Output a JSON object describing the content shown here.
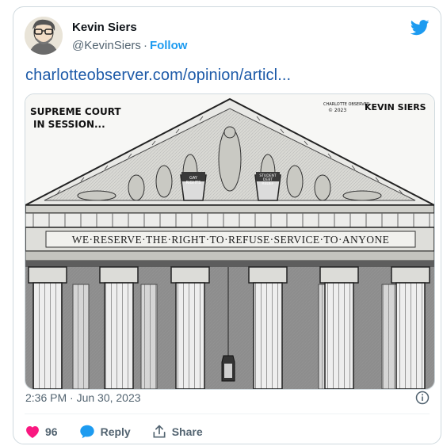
{
  "tweet": {
    "author_name": "Kevin Siers",
    "handle": "@KevinSiers",
    "separator": "·",
    "follow_label": "Follow",
    "link_text": "charlotteobserver.com/opinion/articl...",
    "timestamp": "2:36 PM · Jun 30, 2023"
  },
  "cartoon": {
    "caption": [
      "SUPREME COURT",
      "IN SESSION..."
    ],
    "credit_line1": "CHARLOTTE OBSERVER",
    "credit_line2": "© 2023",
    "signature": "KEVIN SIERS",
    "frieze_text": "WE·RESERVE·THE·RIGHT·TO·REFUSE·SERVICE·TO·ANYONE",
    "bucket_left": [
      "GAY",
      "RIGHTS"
    ],
    "bucket_right": [
      "STUDENT",
      "DEBT",
      "RELIEF"
    ]
  },
  "actions": {
    "like_count": "96",
    "reply_label": "Reply",
    "share_label": "Share"
  },
  "colors": {
    "accent": "#1d9bf0",
    "like": "#f91880",
    "link": "#1d5aa8",
    "muted": "#536471"
  },
  "icons": [
    "twitter-bird-icon",
    "info-icon",
    "heart-icon",
    "reply-bubble-icon",
    "share-icon"
  ]
}
